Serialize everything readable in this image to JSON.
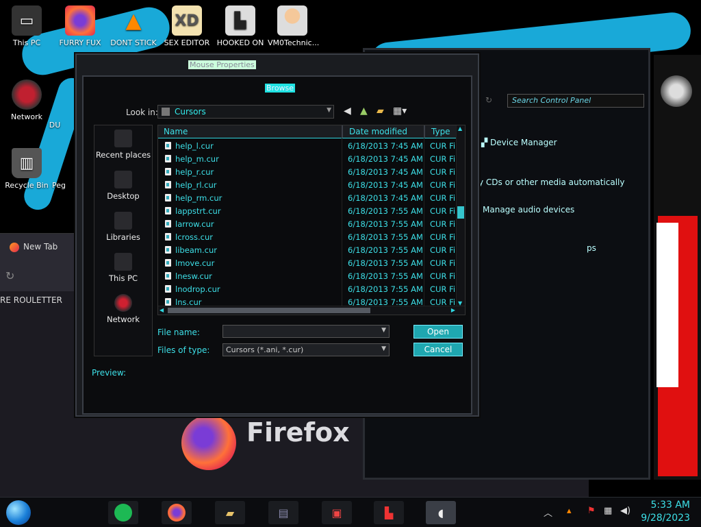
{
  "desktop_icons": [
    {
      "label": "This PC"
    },
    {
      "label": "FURRY FUX"
    },
    {
      "label": "DONT STICK"
    },
    {
      "label": "SEX EDITOR"
    },
    {
      "label": "HOOKED ON"
    },
    {
      "label": "VM0Technic..."
    },
    {
      "label": "Network"
    },
    {
      "label": "DU"
    },
    {
      "label": "Recycle Bin"
    },
    {
      "label": "Peg"
    }
  ],
  "background": {
    "firefox": {
      "tab_label": "New Tab",
      "bookmark": "RE ROULETTER",
      "logo_text": "Firefox"
    },
    "control_panel": {
      "search_placeholder": "Search Control Panel",
      "device_manager": "Device Manager",
      "autoplay_text": "y CDs or other media automatically",
      "manage_audio": "Manage audio devices",
      "ps_text": "ps"
    }
  },
  "dialog": {
    "outer_title": "Mouse Properties",
    "title": "Browse",
    "look_in_label": "Look in:",
    "look_in_value": "Cursors",
    "places": [
      {
        "label": "Recent places"
      },
      {
        "label": "Desktop"
      },
      {
        "label": "Libraries"
      },
      {
        "label": "This PC"
      },
      {
        "label": "Network"
      }
    ],
    "columns": {
      "name": "Name",
      "date": "Date modified",
      "type": "Type"
    },
    "files": [
      {
        "name": "help_l.cur",
        "date": "6/18/2013 7:45 AM",
        "type": "CUR File"
      },
      {
        "name": "help_m.cur",
        "date": "6/18/2013 7:45 AM",
        "type": "CUR File"
      },
      {
        "name": "help_r.cur",
        "date": "6/18/2013 7:45 AM",
        "type": "CUR File"
      },
      {
        "name": "help_rl.cur",
        "date": "6/18/2013 7:45 AM",
        "type": "CUR File"
      },
      {
        "name": "help_rm.cur",
        "date": "6/18/2013 7:45 AM",
        "type": "CUR File"
      },
      {
        "name": "lappstrt.cur",
        "date": "6/18/2013 7:55 AM",
        "type": "CUR File"
      },
      {
        "name": "larrow.cur",
        "date": "6/18/2013 7:55 AM",
        "type": "CUR File"
      },
      {
        "name": "lcross.cur",
        "date": "6/18/2013 7:55 AM",
        "type": "CUR File"
      },
      {
        "name": "libeam.cur",
        "date": "6/18/2013 7:55 AM",
        "type": "CUR File"
      },
      {
        "name": "lmove.cur",
        "date": "6/18/2013 7:55 AM",
        "type": "CUR File"
      },
      {
        "name": "lnesw.cur",
        "date": "6/18/2013 7:55 AM",
        "type": "CUR File"
      },
      {
        "name": "lnodrop.cur",
        "date": "6/18/2013 7:55 AM",
        "type": "CUR File"
      },
      {
        "name": "lns.cur",
        "date": "6/18/2013 7:55 AM",
        "type": "CUR File"
      }
    ],
    "file_name_label": "File name:",
    "file_name_value": "",
    "file_type_label": "Files of type:",
    "file_type_value": "Cursors (*.ani, *.cur)",
    "open_label": "Open",
    "cancel_label": "Cancel",
    "preview_label": "Preview:"
  },
  "taskbar": {
    "time": "5:33 AM",
    "date": "9/28/2023"
  },
  "colors": {
    "accent": "#3de0e8",
    "button": "#1fa7b0",
    "swash": "#19a9d8"
  }
}
